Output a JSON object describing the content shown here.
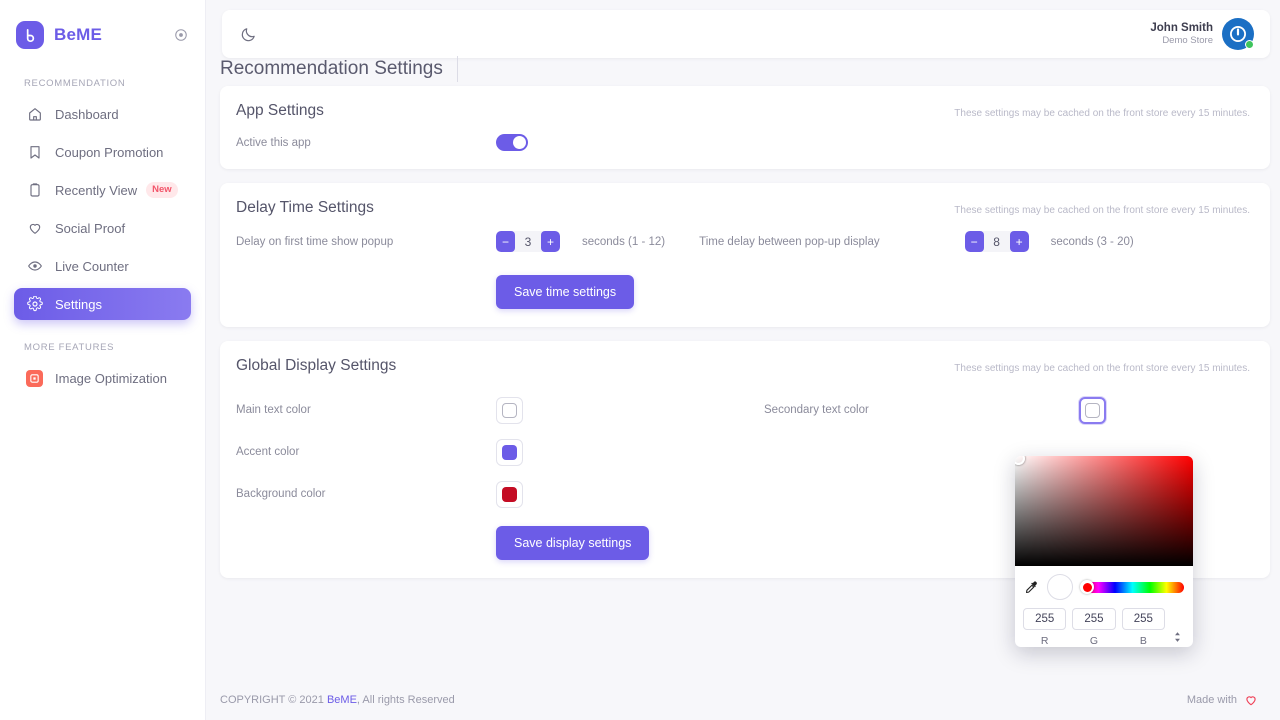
{
  "sidebar": {
    "brand": {
      "name": "BeME",
      "logo_icon": "beme-logo-icon",
      "collapse_icon": "collapse-circle-icon"
    },
    "sections": [
      {
        "title": "RECOMMENDATION",
        "items": [
          {
            "label": "Dashboard",
            "icon": "home-icon",
            "active": false,
            "badge": ""
          },
          {
            "label": "Coupon Promotion",
            "icon": "bookmark-icon",
            "active": false,
            "badge": ""
          },
          {
            "label": "Recently View",
            "icon": "clipboard-icon",
            "active": false,
            "badge": "New"
          },
          {
            "label": "Social Proof",
            "icon": "heart-icon",
            "active": false,
            "badge": ""
          },
          {
            "label": "Live Counter",
            "icon": "eye-icon",
            "active": false,
            "badge": ""
          },
          {
            "label": "Settings",
            "icon": "gear-icon",
            "active": true,
            "badge": ""
          }
        ]
      },
      {
        "title": "MORE FEATURES",
        "items": [
          {
            "label": "Image Optimization",
            "icon": "image-optimization-icon",
            "active": false,
            "badge": ""
          }
        ]
      }
    ]
  },
  "topbar": {
    "theme_toggle_icon": "moon-icon",
    "user_name": "John Smith",
    "user_store": "Demo Store",
    "avatar_icon": "power-avatar-icon",
    "status": "online"
  },
  "page_title": "Recommendation Settings",
  "cache_note": "These settings may be cached on the front store every 15 minutes.",
  "cards": {
    "app_settings": {
      "title": "App Settings",
      "active_label": "Active this app",
      "active_on": true
    },
    "delay_time": {
      "title": "Delay Time Settings",
      "first_delay_label": "Delay on first time show popup",
      "first_delay_value": "3",
      "first_delay_hint": "seconds (1 - 12)",
      "between_delay_label": "Time delay between pop-up display",
      "between_delay_value": "8",
      "between_delay_hint": "seconds (3 - 20)",
      "minus_label": "−",
      "plus_label": "+",
      "save_label": "Save time settings"
    },
    "global_display": {
      "title": "Global Display Settings",
      "main_text_color_label": "Main text color",
      "main_text_color_value": "#FFFFFF",
      "accent_color_label": "Accent color",
      "accent_color_value": "#6C5CE7",
      "background_color_label": "Background color",
      "background_color_value": "#C40C24",
      "secondary_text_color_label": "Secondary text color",
      "secondary_text_color_value": "#FFFFFF",
      "save_label": "Save display settings"
    }
  },
  "color_picker": {
    "open": true,
    "eyedropper_icon": "eyedropper-icon",
    "preview_color": "#FFFFFF",
    "hue_color": "#FF0000",
    "r_value": "255",
    "g_value": "255",
    "b_value": "255",
    "r_label": "R",
    "g_label": "G",
    "b_label": "B",
    "format_toggle_icon": "updown-arrows-icon"
  },
  "footer": {
    "copyright_prefix": "COPYRIGHT © 2021 ",
    "brand_link": "BeME",
    "copyright_suffix": ", All rights Reserved",
    "made_with": "Made with",
    "heart_icon": "heart-icon"
  }
}
